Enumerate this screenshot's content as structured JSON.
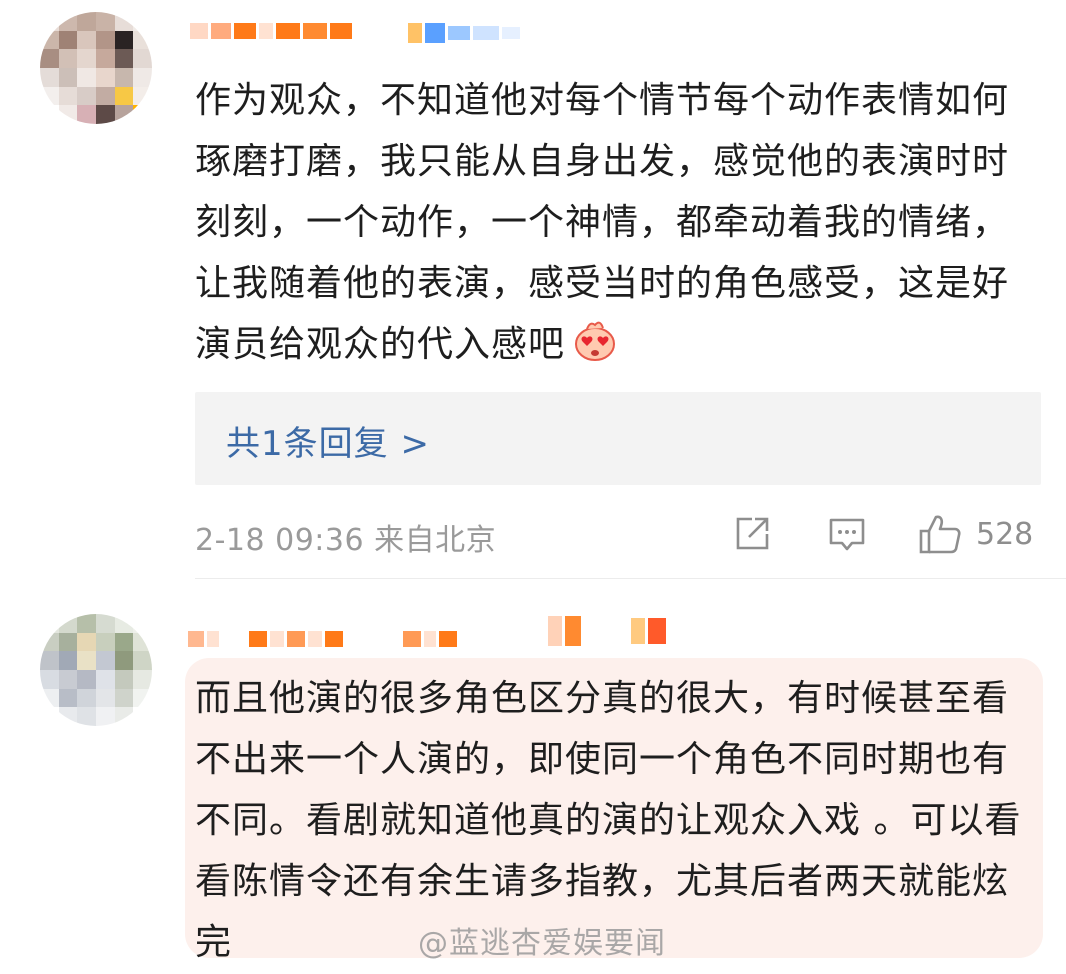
{
  "comment1": {
    "text": "作为观众，不知道他对每个情节每个动作表情如何琢磨打磨，我只能从自身出发，感觉他的表演时时刻刻，一个动作，一个神情，都牵动着我的情绪，让我随着他的表演，感受当时的角色感受，这是好演员给观众的代入感吧",
    "emoji": "heart-eyes-emoji",
    "reply_link": "共1条回复 >",
    "meta": "2-18 09:36 来自北京",
    "like_count": "528",
    "icons": [
      "share-icon",
      "comment-icon",
      "thumbs-up-icon"
    ]
  },
  "comment2": {
    "text": "而且他演的很多角色区分真的很大，有时候甚至看不出来一个人演的，即使同一个角色不同时期也有不同。看剧就知道他真的演的让观众入戏 。可以看看陈情令还有余生请多指教，尤其后者两天就能炫完",
    "watermark": "@蓝逃杏爱娱要闻"
  },
  "colors": {
    "link": "#3c6aa6",
    "meta": "#9a9a9a",
    "reply_bg": "#f3f3f3",
    "highlight_bg": "#fdf0ec",
    "accent_orange": "#ff7a18"
  }
}
